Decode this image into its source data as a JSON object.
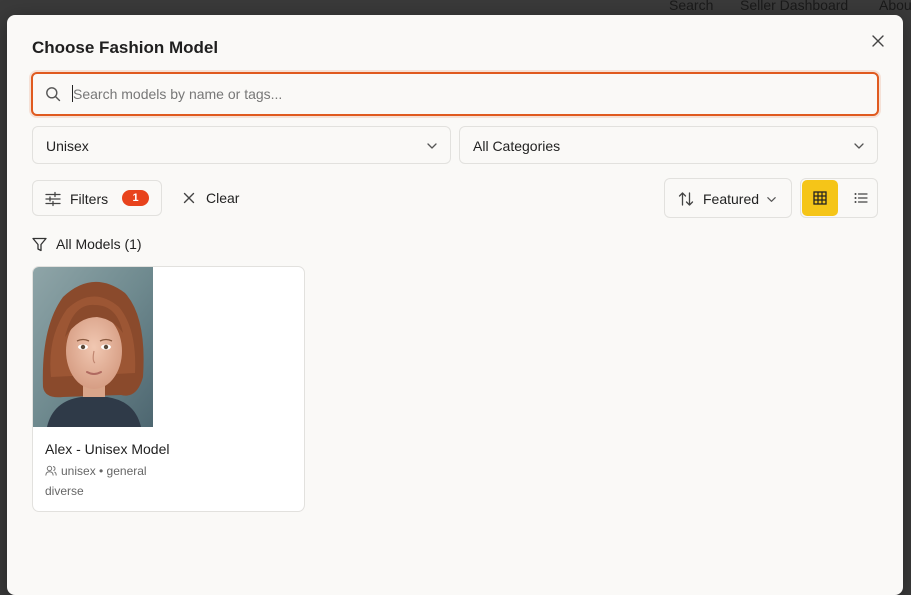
{
  "backdrop": {
    "nav": [
      "Search",
      "Seller Dashboard",
      "Abou"
    ]
  },
  "modal": {
    "title": "Choose Fashion Model",
    "search": {
      "placeholder": "Search models by name or tags...",
      "value": ""
    },
    "gender_select": {
      "value": "Unisex"
    },
    "category_select": {
      "value": "All Categories"
    },
    "filters": {
      "label": "Filters",
      "count": "1"
    },
    "clear": {
      "label": "Clear"
    },
    "sort": {
      "label": "Featured"
    },
    "view_mode": "grid",
    "section": {
      "label": "All Models (1)"
    },
    "models": [
      {
        "name": "Alex - Unisex Model",
        "meta": "unisex • general",
        "tag": "diverse"
      }
    ]
  },
  "colors": {
    "accent_border": "#e05a1f",
    "badge": "#e8431c",
    "active_view": "#f5c518"
  }
}
